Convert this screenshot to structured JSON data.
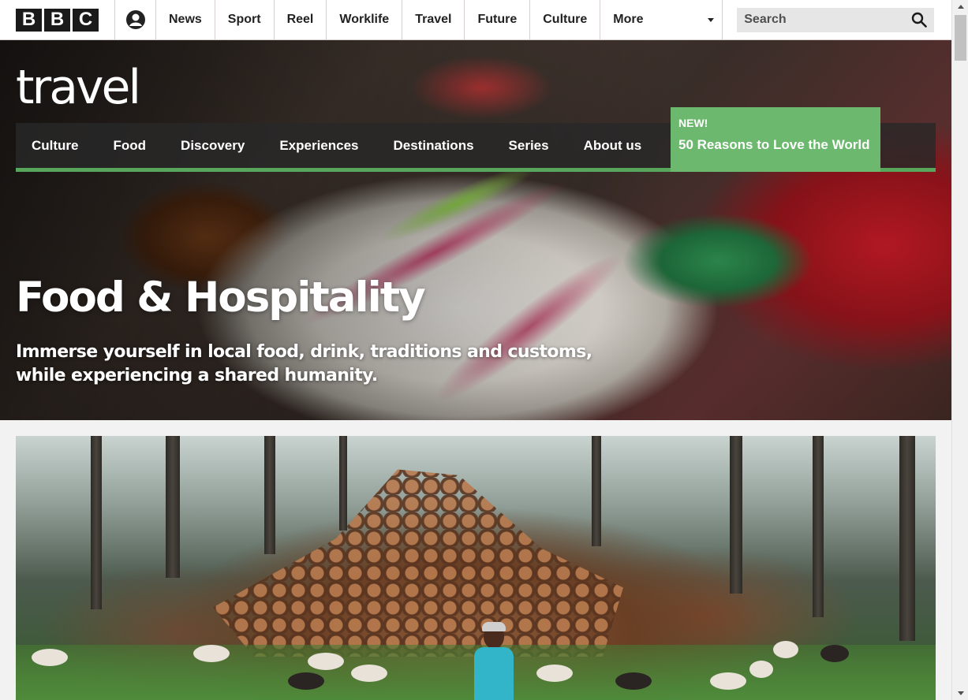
{
  "header": {
    "brand_letters": [
      "B",
      "B",
      "C"
    ],
    "nav": [
      {
        "label": "News"
      },
      {
        "label": "Sport"
      },
      {
        "label": "Reel"
      },
      {
        "label": "Worklife"
      },
      {
        "label": "Travel"
      },
      {
        "label": "Future"
      },
      {
        "label": "Culture"
      }
    ],
    "more_label": "More",
    "search": {
      "placeholder": "Search"
    }
  },
  "travel": {
    "logo": "travel",
    "sub_nav": [
      {
        "label": "Culture"
      },
      {
        "label": "Food"
      },
      {
        "label": "Discovery"
      },
      {
        "label": "Experiences"
      },
      {
        "label": "Destinations"
      },
      {
        "label": "Series"
      },
      {
        "label": "About us"
      }
    ],
    "promo": {
      "badge": "NEW!",
      "title": "50 Reasons to Love the World"
    }
  },
  "hero": {
    "title": "Food & Hospitality",
    "description": "Immerse yourself in local food, drink, traditions and customs, while experiencing a shared humanity."
  },
  "colors": {
    "brand_green": "#6db86f",
    "nav_background": "#282828",
    "page_background": "#f2f2f2"
  },
  "icons": [
    "account-icon",
    "search-icon",
    "chevron-down-icon"
  ]
}
